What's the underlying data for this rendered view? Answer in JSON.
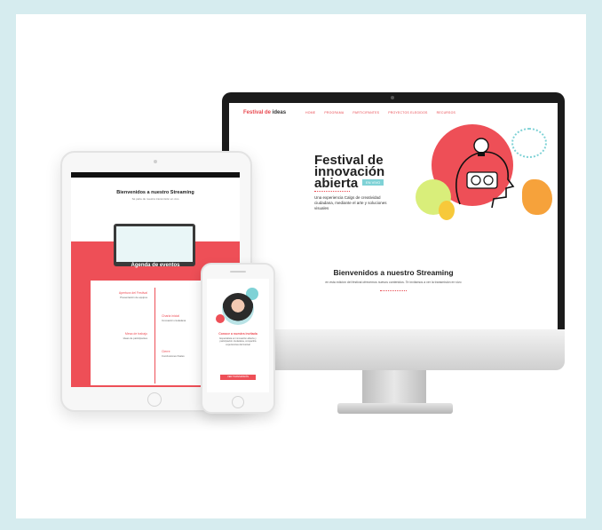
{
  "colors": {
    "accent": "#ee4f57",
    "teal": "#7fd2d6",
    "background": "#d6ecef",
    "lime": "#d9ee7a"
  },
  "desktop": {
    "logo_text": "Festival de",
    "logo_highlight": "ideas",
    "nav": [
      "HOME",
      "PROGRAMA",
      "PARTICIPANTES",
      "PROYECTOS ELEGIDOS",
      "RECURSOS"
    ],
    "hero_title": "Festival de innovación abierta",
    "hero_tag": "EN VIVO",
    "hero_description": "Una experiencia Calgs de creatividad ciudadana, mediante el arte y soluciones visuales",
    "welcome_title": "Bienvenidos a nuestro Streaming",
    "welcome_subtitle": "en esta edición del festival ofrecemos nuevos contenidos. Te invitamos a ver la transmisión en vivo"
  },
  "tablet": {
    "title": "Bienvenidos a nuestro Streaming",
    "subtitle": "Sé parte de nuestra transmisión en vivo",
    "agenda_title": "Agenda de eventos",
    "timeline": [
      {
        "label": "Apertura del Festival",
        "text": "Presentación de equipos"
      },
      {
        "label": "Charla inicial",
        "text": "Innovación ciudadana"
      },
      {
        "label": "Mesa de trabajo",
        "text": "Ideas de participantes"
      },
      {
        "label": "Cierre",
        "text": "Conclusiones finales"
      }
    ]
  },
  "phone": {
    "name": "Conoce a nuestra invitada",
    "bio": "Especialista en innovación abierta y participación ciudadana, compartirá experiencias del festival",
    "button": "VER TRANSMISIÓN"
  }
}
